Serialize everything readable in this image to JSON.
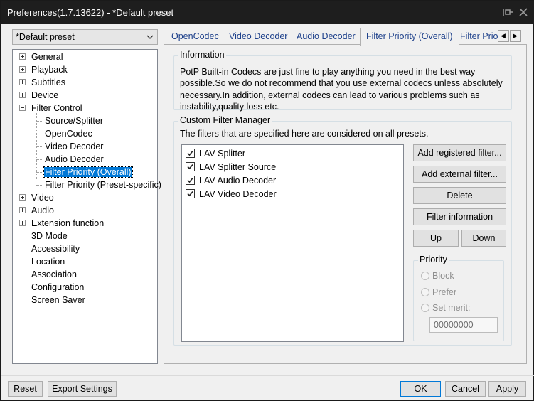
{
  "window": {
    "title": "Preferences(1.7.13622) - *Default preset",
    "pin_icon": "pin-icon",
    "close_icon": "close-icon"
  },
  "preset": {
    "selected": "*Default preset"
  },
  "tree": {
    "items": [
      {
        "label": "General",
        "expander": "plus"
      },
      {
        "label": "Playback",
        "expander": "plus"
      },
      {
        "label": "Subtitles",
        "expander": "plus"
      },
      {
        "label": "Device",
        "expander": "plus"
      },
      {
        "label": "Filter Control",
        "expander": "minus"
      },
      {
        "label": "Source/Splitter",
        "expander": "none"
      },
      {
        "label": "OpenCodec",
        "expander": "none"
      },
      {
        "label": "Video Decoder",
        "expander": "none"
      },
      {
        "label": "Audio Decoder",
        "expander": "none"
      },
      {
        "label": "Filter Priority (Overall)",
        "expander": "none",
        "selected": true
      },
      {
        "label": "Filter Priority (Preset-specific)",
        "expander": "none"
      },
      {
        "label": "Video",
        "expander": "plus"
      },
      {
        "label": "Audio",
        "expander": "plus"
      },
      {
        "label": "Extension function",
        "expander": "plus"
      },
      {
        "label": "3D Mode",
        "expander": "none"
      },
      {
        "label": "Accessibility",
        "expander": "none"
      },
      {
        "label": "Location",
        "expander": "none"
      },
      {
        "label": "Association",
        "expander": "none"
      },
      {
        "label": "Configuration",
        "expander": "none"
      },
      {
        "label": "Screen Saver",
        "expander": "none"
      }
    ]
  },
  "tabs": [
    {
      "label": "OpenCodec"
    },
    {
      "label": "Video Decoder"
    },
    {
      "label": "Audio Decoder"
    },
    {
      "label": "Filter Priority (Overall)",
      "active": true
    },
    {
      "label": "Filter Prio"
    }
  ],
  "information": {
    "title": "Information",
    "text": "PotP Built-in Codecs are just fine to play anything you need in the best way possible.So we do not recommend that you use external codecs unless absolutely necessary.In addition, external codecs can lead to various problems such as instability,quality loss etc."
  },
  "filter_manager": {
    "title": "Custom Filter Manager",
    "description": "The filters that are specified here are considered on all presets.",
    "filters": [
      {
        "name": "LAV Splitter",
        "checked": true
      },
      {
        "name": "LAV Splitter Source",
        "checked": true
      },
      {
        "name": "LAV Audio Decoder",
        "checked": true
      },
      {
        "name": "LAV Video Decoder",
        "checked": true
      }
    ],
    "buttons": {
      "add_registered": "Add registered filter...",
      "add_external": "Add external filter...",
      "delete": "Delete",
      "filter_information": "Filter information",
      "up": "Up",
      "down": "Down"
    },
    "priority": {
      "title": "Priority",
      "block": "Block",
      "prefer": "Prefer",
      "set_merit": "Set merit:",
      "merit_value": "00000000"
    }
  },
  "footer": {
    "reset": "Reset",
    "export": "Export Settings",
    "ok": "OK",
    "cancel": "Cancel",
    "apply": "Apply"
  }
}
